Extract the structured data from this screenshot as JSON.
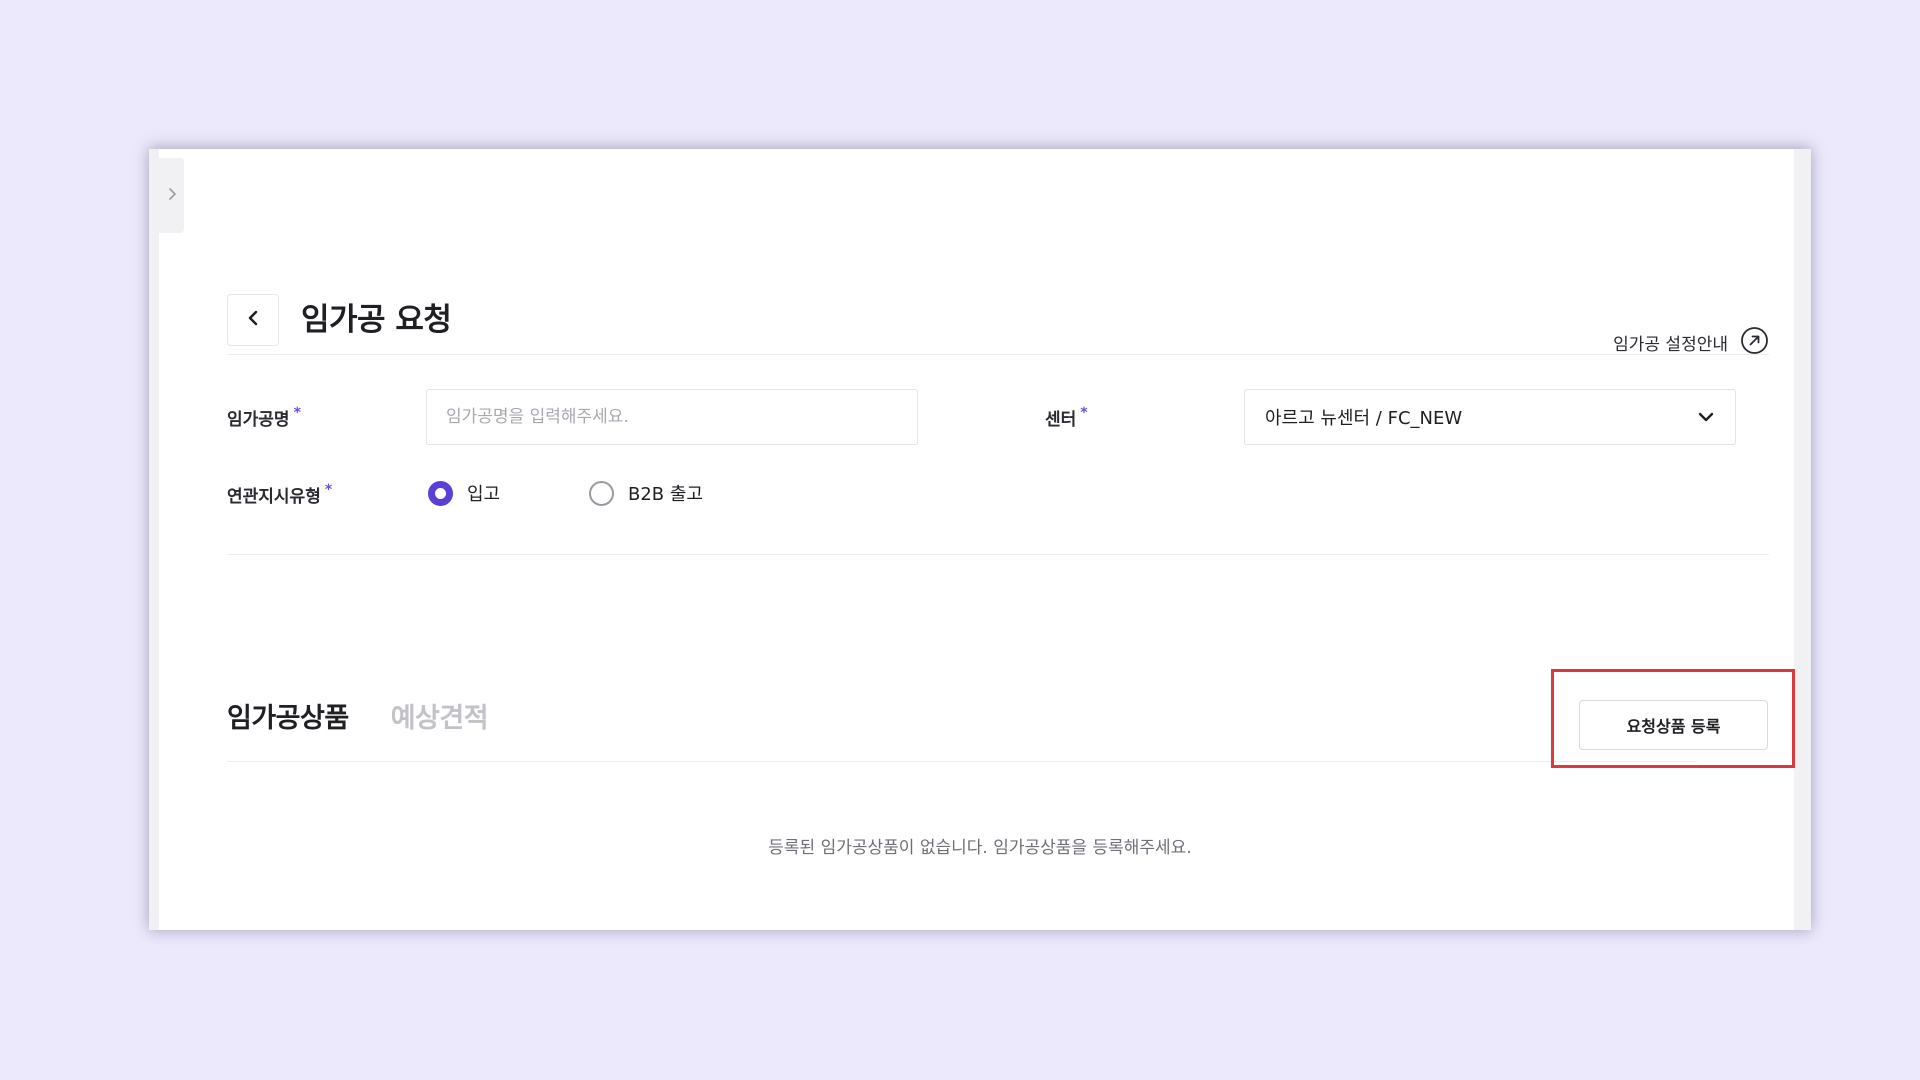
{
  "page": {
    "title": "임가공 요청",
    "guide_link": "임가공 설정안내"
  },
  "form": {
    "name_label": "임가공명",
    "name_placeholder": "임가공명을 입력해주세요.",
    "name_value": "",
    "center_label": "센터",
    "center_value": "아르고 뉴센터 / FC_NEW",
    "related_type_label": "연관지시유형",
    "required_mark": "*",
    "radio_options": [
      {
        "label": "입고",
        "selected": true
      },
      {
        "label": "B2B 출고",
        "selected": false
      }
    ]
  },
  "tabs": [
    {
      "label": "임가공상품",
      "active": true
    },
    {
      "label": "예상견적",
      "active": false
    }
  ],
  "actions": {
    "register_label": "요청상품 등록"
  },
  "empty_state": {
    "message": "등록된 임가공상품이 없습니다. 임가공상품을 등록해주세요."
  },
  "colors": {
    "background": "#ece9fc",
    "accent": "#5b3fd6",
    "highlight": "#d93a3a"
  },
  "icons": {
    "sidebar_toggle": "chevron-right-icon",
    "back": "chevron-left-icon",
    "guide": "external-link-arrow-icon",
    "select": "chevron-down-icon"
  }
}
